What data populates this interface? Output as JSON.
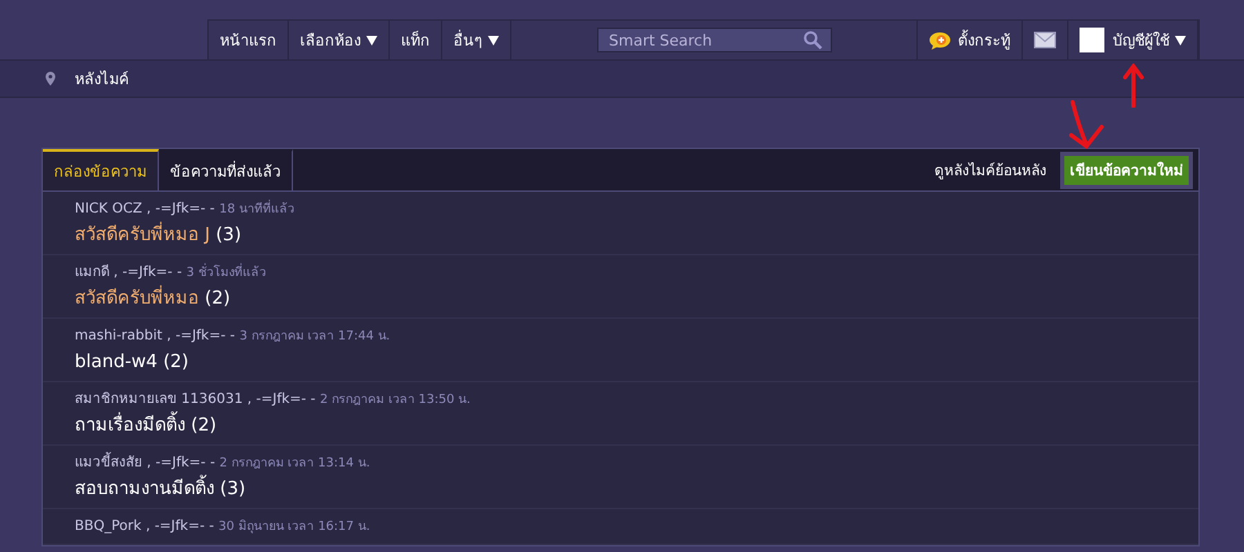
{
  "nav": {
    "items": [
      {
        "label": "หน้าแรก",
        "dropdown": false
      },
      {
        "label": "เลือกห้อง",
        "dropdown": true
      },
      {
        "label": "แท็ก",
        "dropdown": false
      },
      {
        "label": "อื่นๆ",
        "dropdown": true
      }
    ],
    "search": {
      "placeholder": "Smart Search"
    },
    "post_label": "ตั้งกระทู้",
    "account": {
      "label": "บัญชีผู้ใช้",
      "dropdown": true
    }
  },
  "breadcrumb": "หลังไมค์",
  "tabs": [
    {
      "label": "กล่องข้อความ",
      "selected": true
    },
    {
      "label": "ข้อความที่ส่งแล้ว",
      "selected": false
    }
  ],
  "history_link": "ดูหลังไมค์ย้อนหลัง",
  "compose_button": "เขียนข้อความใหม่",
  "messages": [
    {
      "sender": "NICK OCZ , -=Jfk=- -",
      "time": "18 นาทีที่แล้ว",
      "subject": "สวัสดีครับพี่หมอ J",
      "count": "(3)",
      "unread": true
    },
    {
      "sender": "แมกดี , -=Jfk=- -",
      "time": "3 ชั่วโมงที่แล้ว",
      "subject": "สวัสดีครับพี่หมอ",
      "count": "(2)",
      "unread": true
    },
    {
      "sender": "mashi-rabbit , -=Jfk=- -",
      "time": "3 กรกฎาคม เวลา 17:44 น.",
      "subject": "bland-w4",
      "count": "(2)",
      "unread": false
    },
    {
      "sender": "สมาชิกหมายเลข 1136031 , -=Jfk=- -",
      "time": "2 กรกฎาคม เวลา 13:50 น.",
      "subject": "ถามเรื่องมีดติ้ง",
      "count": "(2)",
      "unread": false
    },
    {
      "sender": "แมวขี้สงสัย , -=Jfk=- -",
      "time": "2 กรกฎาคม เวลา 13:14 น.",
      "subject": "สอบถามงานมีดติ้ง",
      "count": "(3)",
      "unread": false
    },
    {
      "sender": "BBQ_Pork , -=Jfk=- -",
      "time": "30 มิถุนายน เวลา 16:17 น."
    }
  ]
}
